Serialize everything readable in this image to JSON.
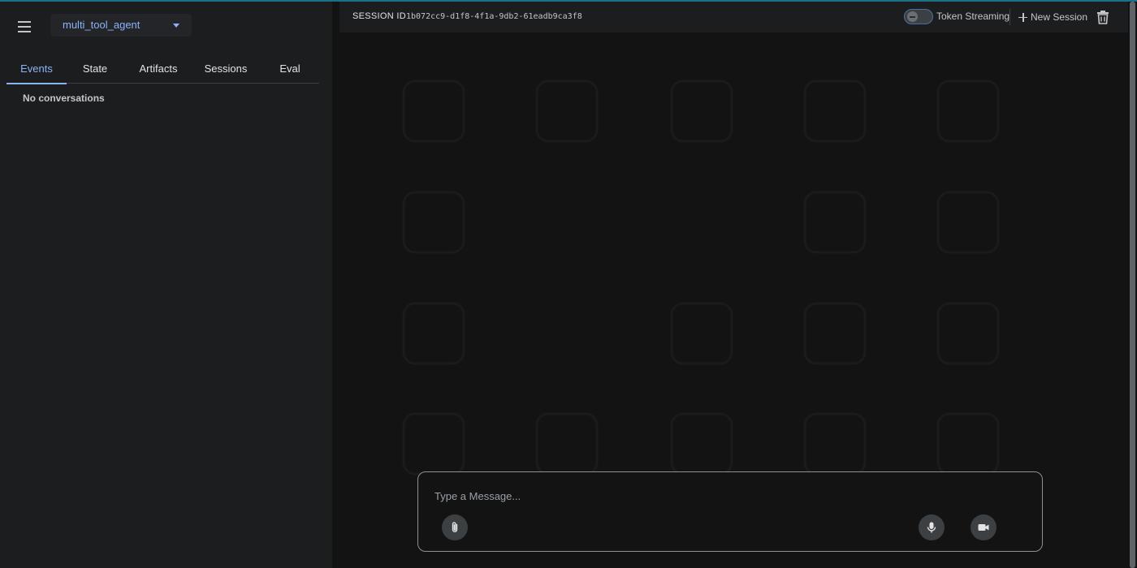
{
  "sidebar": {
    "agent": "multi_tool_agent",
    "tabs": [
      {
        "label": "Events",
        "active": true
      },
      {
        "label": "State",
        "active": false
      },
      {
        "label": "Artifacts",
        "active": false
      },
      {
        "label": "Sessions",
        "active": false
      },
      {
        "label": "Eval",
        "active": false
      }
    ],
    "empty_message": "No conversations"
  },
  "toolbar": {
    "session_label": "SESSION ID",
    "session_id": "1b072cc9-d1f8-4f1a-9db2-61eadb9ca3f8",
    "token_streaming_label": "Token Streaming",
    "token_streaming_on": false,
    "new_session_label": "New Session"
  },
  "composer": {
    "placeholder": "Type a Message..."
  },
  "icons": {
    "menu": "menu-icon",
    "dropdown": "chevron-down-icon",
    "add": "plus-icon",
    "delete": "trash-icon",
    "attach": "paperclip-icon",
    "mic": "microphone-icon",
    "video": "video-camera-icon"
  },
  "colors": {
    "accent": "#8ab4f8",
    "sidebar_bg": "#1c1d1f",
    "main_bg": "#131314",
    "top_accent": "#1b6f87"
  }
}
